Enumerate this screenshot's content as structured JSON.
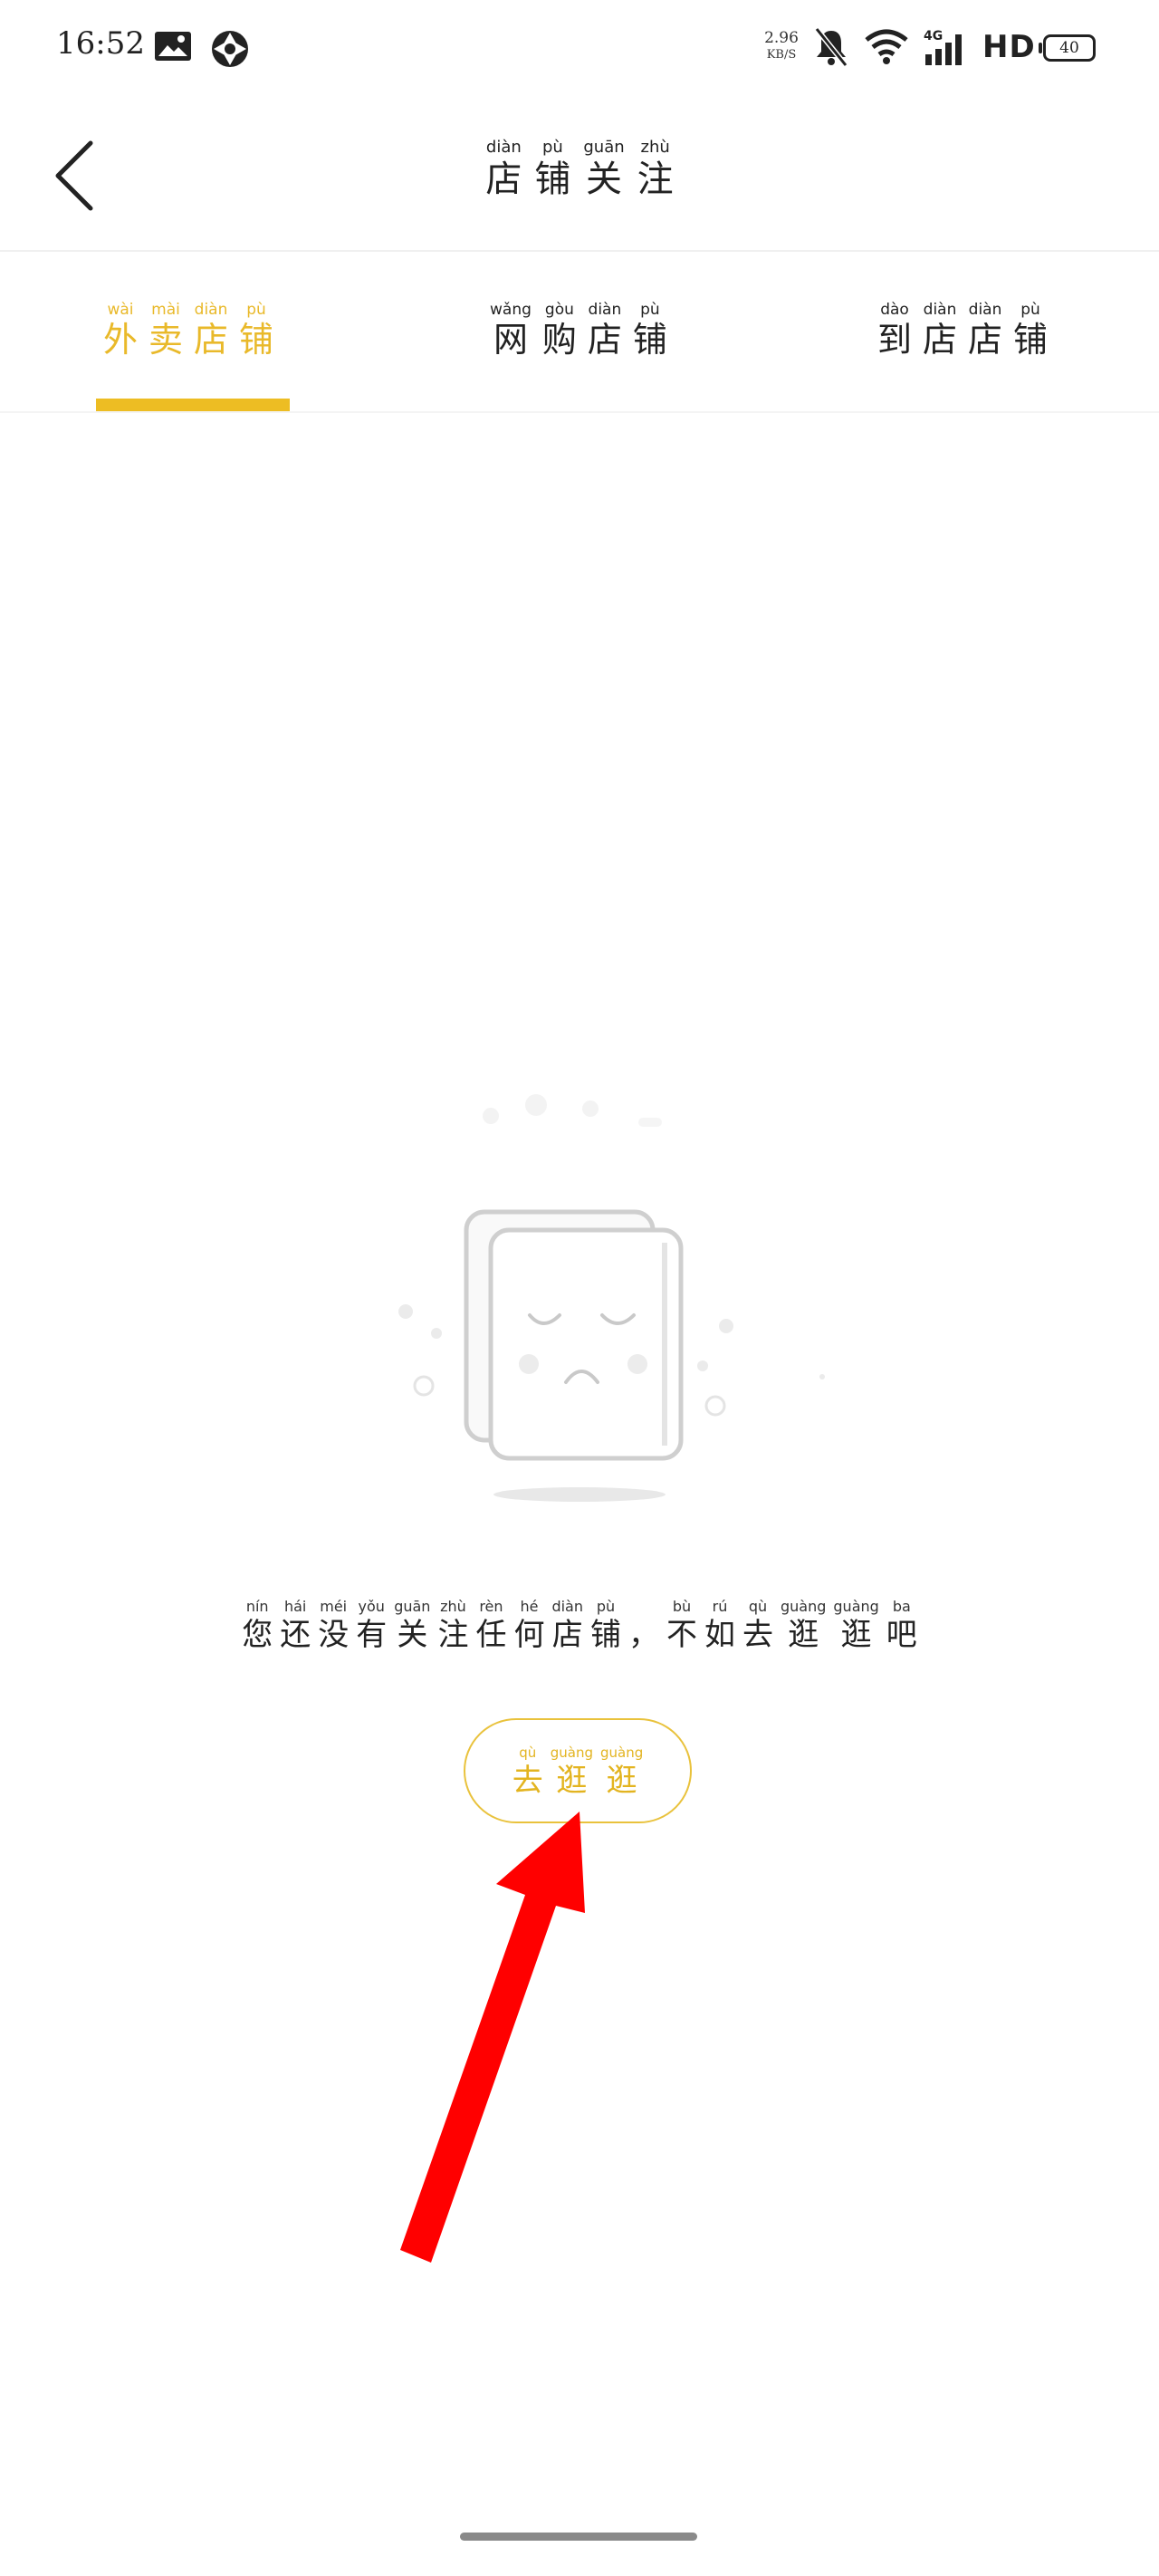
{
  "status_bar": {
    "time": "16:52",
    "net_speed_value": "2.96",
    "net_speed_unit": "KB/S",
    "signal_label": "HD",
    "network_type": "4G",
    "battery_level": "40",
    "icons": [
      "gallery-icon",
      "aperture-icon",
      "mute-bell-icon",
      "wifi-icon",
      "cellular-signal-icon",
      "battery-icon"
    ]
  },
  "header": {
    "title": [
      {
        "py": "diàn",
        "hz": "店"
      },
      {
        "py": "pù",
        "hz": "铺"
      },
      {
        "py": "guān",
        "hz": "关"
      },
      {
        "py": "zhù",
        "hz": "注"
      }
    ]
  },
  "tabs": [
    {
      "id": "takeout",
      "active": true,
      "chars": [
        {
          "py": "wài",
          "hz": "外"
        },
        {
          "py": "mài",
          "hz": "卖"
        },
        {
          "py": "diàn",
          "hz": "店"
        },
        {
          "py": "pù",
          "hz": "铺"
        }
      ]
    },
    {
      "id": "online",
      "active": false,
      "chars": [
        {
          "py": "wǎng",
          "hz": "网"
        },
        {
          "py": "gòu",
          "hz": "购"
        },
        {
          "py": "diàn",
          "hz": "店"
        },
        {
          "py": "pù",
          "hz": "铺"
        }
      ]
    },
    {
      "id": "instore",
      "active": false,
      "chars": [
        {
          "py": "dào",
          "hz": "到"
        },
        {
          "py": "diàn",
          "hz": "店"
        },
        {
          "py": "diàn",
          "hz": "店"
        },
        {
          "py": "pù",
          "hz": "铺"
        }
      ]
    }
  ],
  "empty_state": {
    "message": [
      {
        "py": "nín",
        "hz": "您"
      },
      {
        "py": "hái",
        "hz": "还"
      },
      {
        "py": "méi",
        "hz": "没"
      },
      {
        "py": "yǒu",
        "hz": "有"
      },
      {
        "py": "guān",
        "hz": "关"
      },
      {
        "py": "zhù",
        "hz": "注"
      },
      {
        "py": "rèn",
        "hz": "任"
      },
      {
        "py": "hé",
        "hz": "何"
      },
      {
        "py": "diàn",
        "hz": "店"
      },
      {
        "py": "pù",
        "hz": "铺"
      },
      {
        "py": "",
        "hz": "，"
      },
      {
        "py": "bù",
        "hz": "不"
      },
      {
        "py": "rú",
        "hz": "如"
      },
      {
        "py": "qù",
        "hz": "去"
      },
      {
        "py": "guàng",
        "hz": "逛"
      },
      {
        "py": "guàng",
        "hz": "逛"
      },
      {
        "py": "ba",
        "hz": "吧"
      }
    ],
    "button": [
      {
        "py": "qù",
        "hz": "去"
      },
      {
        "py": "guàng",
        "hz": "逛"
      },
      {
        "py": "guàng",
        "hz": "逛"
      }
    ]
  },
  "colors": {
    "accent": "#e9b92a",
    "annotation_arrow": "#ff0000",
    "text": "#222222"
  }
}
